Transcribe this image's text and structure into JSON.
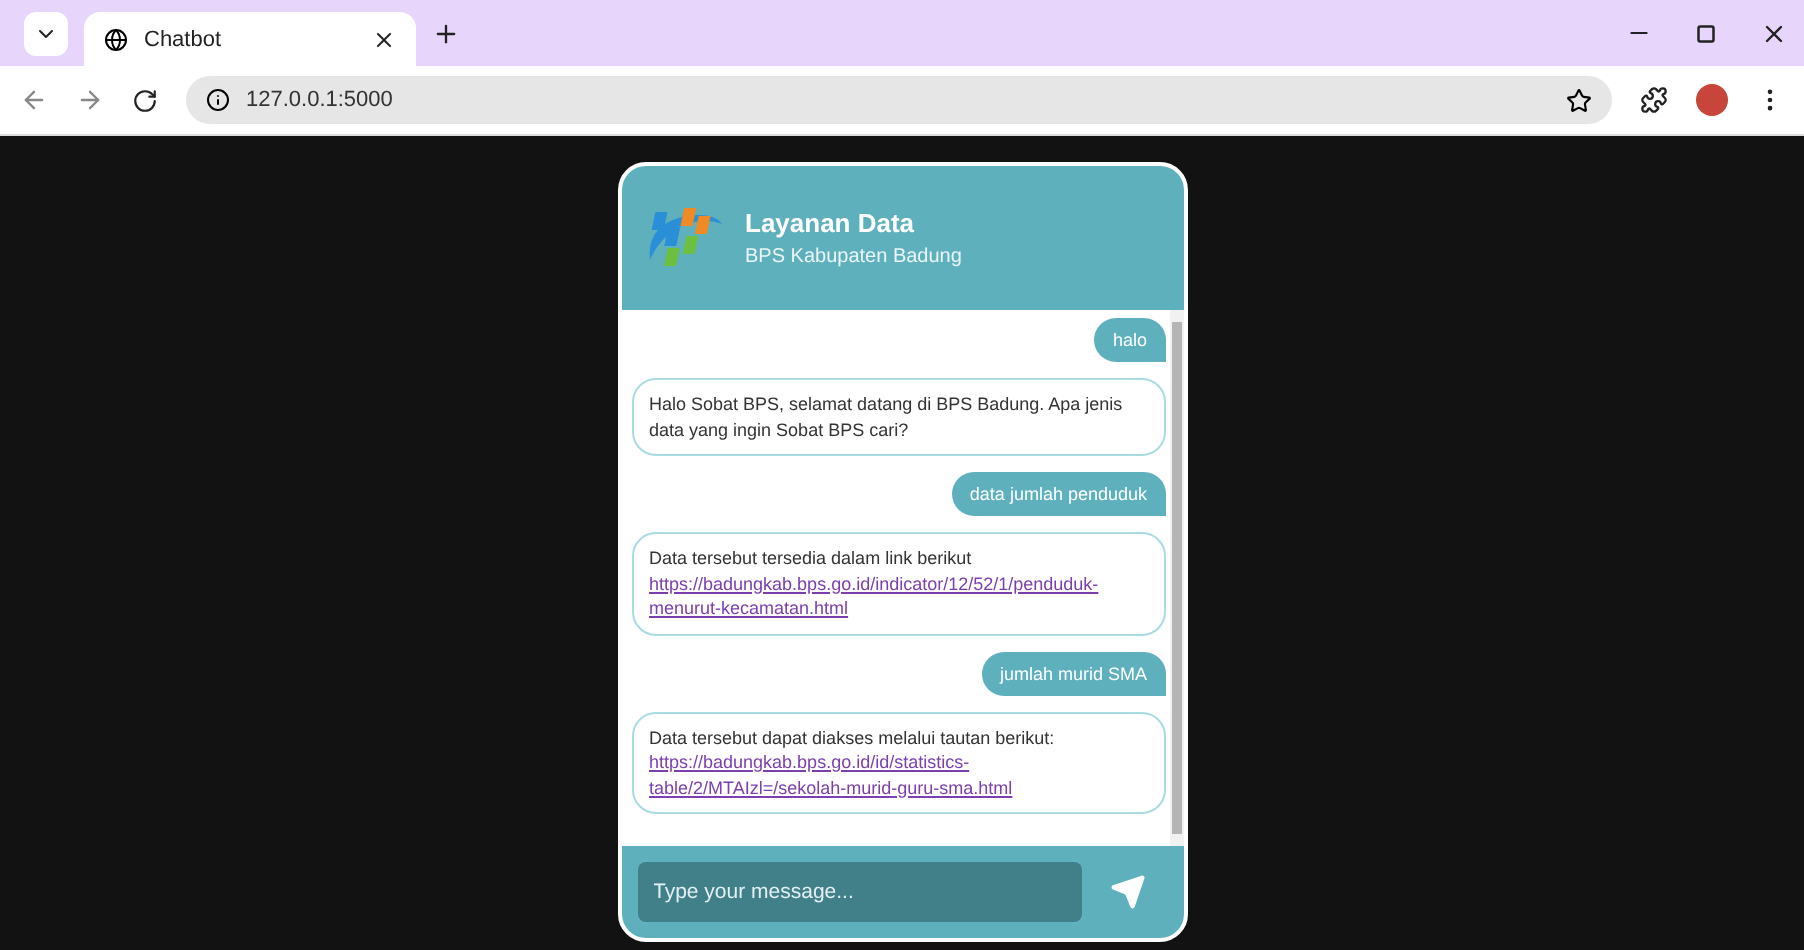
{
  "browser": {
    "tab_title": "Chatbot",
    "url": "127.0.0.1:5000"
  },
  "chat": {
    "title": "Layanan Data",
    "subtitle": "BPS Kabupaten Badung",
    "messages": [
      {
        "kind": "user",
        "text": "halo"
      },
      {
        "kind": "bot",
        "text": "Halo Sobat BPS, selamat datang di BPS Badung. Apa jenis data yang ingin Sobat BPS cari?"
      },
      {
        "kind": "user",
        "text": "data jumlah penduduk"
      },
      {
        "kind": "bot",
        "text": "Data tersebut tersedia dalam link berikut",
        "link": "https://badungkab.bps.go.id/indicator/12/52/1/penduduk-menurut-kecamatan.html"
      },
      {
        "kind": "user",
        "text": "jumlah murid SMA"
      },
      {
        "kind": "bot",
        "text": "Data tersebut dapat diakses melalui tautan berikut:",
        "link": "https://badungkab.bps.go.id/id/statistics-table/2/MTAIzl=/sekolah-murid-guru-sma.html"
      }
    ],
    "input": {
      "placeholder": "Type your message..."
    }
  }
}
